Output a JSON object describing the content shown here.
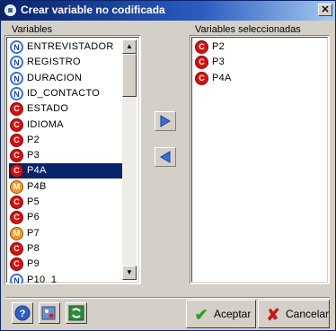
{
  "window": {
    "title": "Crear variable no codificada",
    "close_label": "✕"
  },
  "variables": {
    "label": "Variables",
    "items": [
      {
        "type": "N",
        "name": "ENTREVISTADOR"
      },
      {
        "type": "N",
        "name": "REGISTRO"
      },
      {
        "type": "N",
        "name": "DURACION"
      },
      {
        "type": "N",
        "name": "ID_CONTACTO"
      },
      {
        "type": "C",
        "name": "ESTADO"
      },
      {
        "type": "C",
        "name": "IDIOMA"
      },
      {
        "type": "C",
        "name": "P2"
      },
      {
        "type": "C",
        "name": "P3"
      },
      {
        "type": "C",
        "name": "P4A",
        "selected": true
      },
      {
        "type": "M",
        "name": "P4B"
      },
      {
        "type": "C",
        "name": "P5"
      },
      {
        "type": "C",
        "name": "P6"
      },
      {
        "type": "M",
        "name": "P7"
      },
      {
        "type": "C",
        "name": "P8"
      },
      {
        "type": "C",
        "name": "P9"
      },
      {
        "type": "N",
        "name": "P10_1"
      }
    ]
  },
  "selected_variables": {
    "label": "Variables seleccionadas",
    "items": [
      {
        "type": "C",
        "name": "P2"
      },
      {
        "type": "C",
        "name": "P3"
      },
      {
        "type": "C",
        "name": "P4A"
      }
    ]
  },
  "badge_letters": {
    "N": "N",
    "C": "C",
    "M": "M"
  },
  "buttons": {
    "accept": "Aceptar",
    "cancel": "Cancelar"
  },
  "colors": {
    "selection": "#0a246a",
    "arrow": "#3a6fd8",
    "accept_check": "#2e9a2e",
    "cancel_x": "#c81818"
  }
}
